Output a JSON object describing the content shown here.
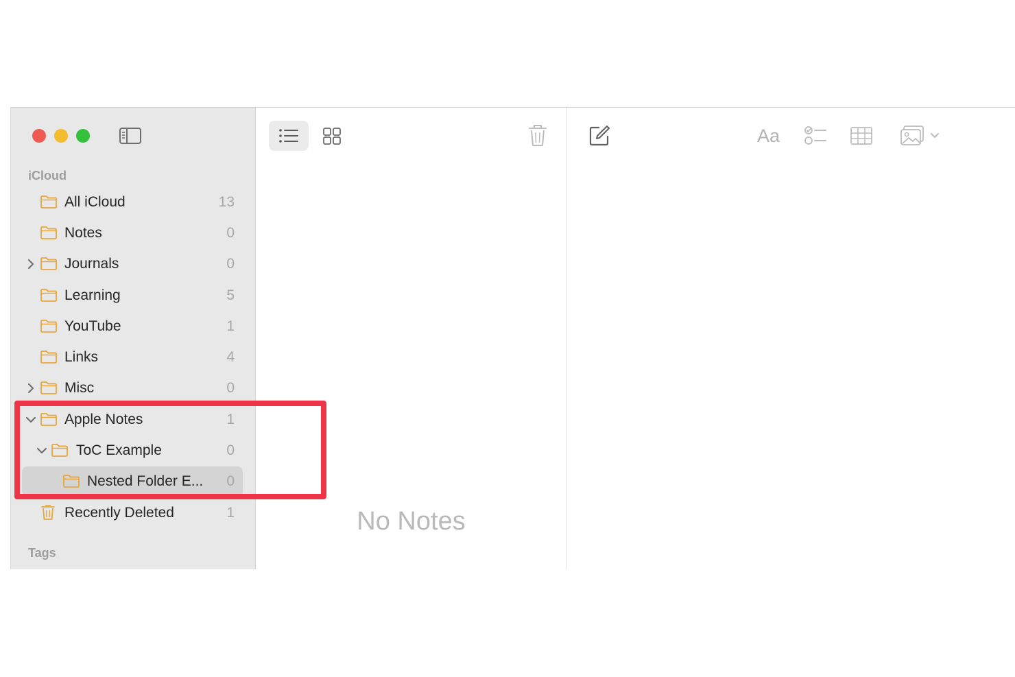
{
  "sidebar": {
    "section_label": "iCloud",
    "tags_label": "Tags",
    "folders": [
      {
        "label": "All iCloud",
        "count": "13"
      },
      {
        "label": "Notes",
        "count": "0"
      },
      {
        "label": "Journals",
        "count": "0"
      },
      {
        "label": "Learning",
        "count": "5"
      },
      {
        "label": "YouTube",
        "count": "1"
      },
      {
        "label": "Links",
        "count": "4"
      },
      {
        "label": "Misc",
        "count": "0"
      },
      {
        "label": "Apple Notes",
        "count": "1"
      },
      {
        "label": "ToC Example",
        "count": "0"
      },
      {
        "label": "Nested Folder E...",
        "count": "0"
      },
      {
        "label": "Recently Deleted",
        "count": "1"
      }
    ]
  },
  "list": {
    "empty_label": "No Notes"
  },
  "editor": {
    "format_label": "Aa"
  },
  "icons": {
    "sidebar_toggle": "sidebar-toggle-icon",
    "list_view": "list-view-icon",
    "gallery_view": "gallery-view-icon",
    "trash": "trash-icon",
    "compose": "compose-icon",
    "checklist": "checklist-icon",
    "table": "table-icon",
    "media": "media-icon",
    "folder": "folder-icon",
    "chevron_right": "chevron-right-icon",
    "chevron_down": "chevron-down-icon"
  },
  "colors": {
    "folder_accent": "#e8a53a",
    "highlight": "#ee3447",
    "close": "#ee5b55",
    "minimize": "#f3bd2f",
    "zoom": "#35c13d"
  }
}
